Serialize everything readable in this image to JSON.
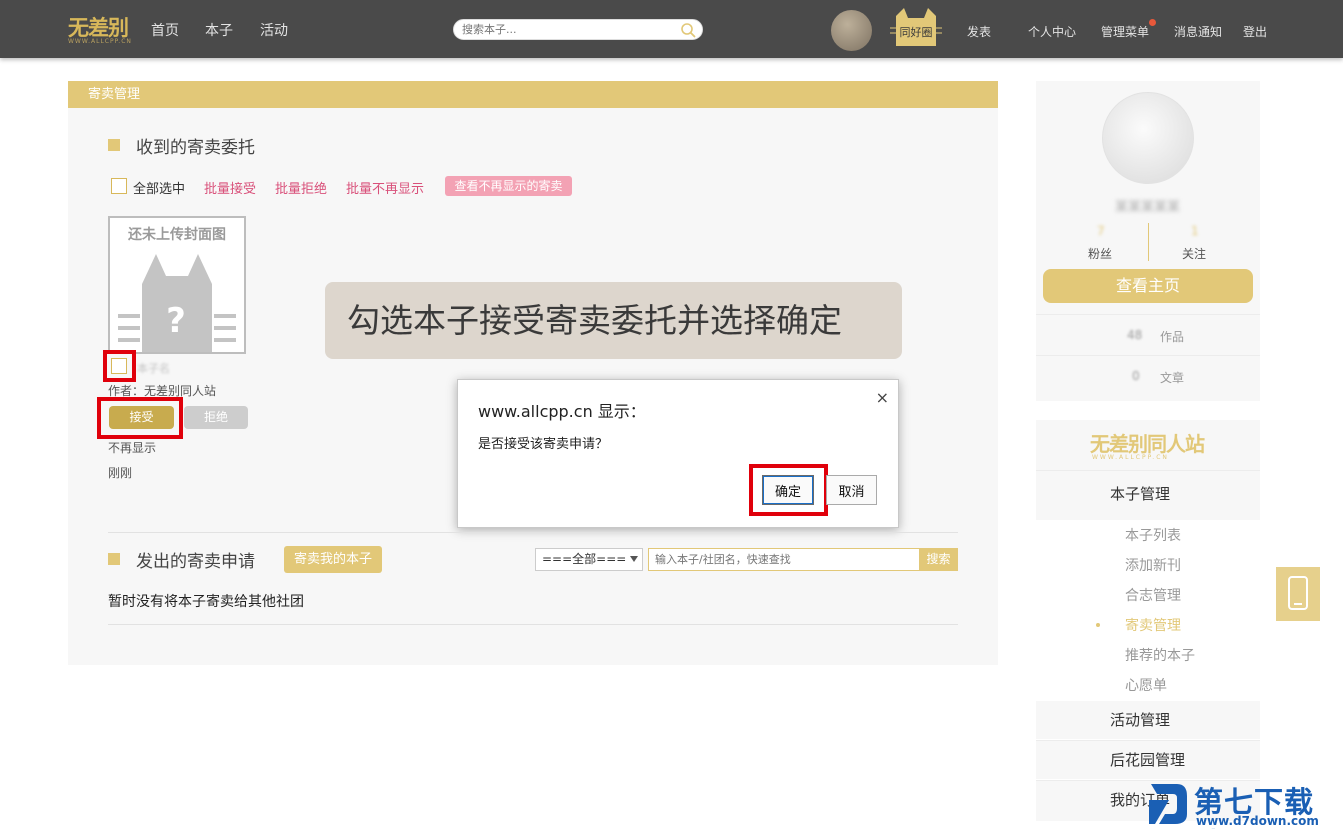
{
  "header": {
    "logo_text": "无差别",
    "logo_sub": "WWW.ALLCPP.CN",
    "nav": [
      "首页",
      "本子",
      "活动"
    ],
    "search_placeholder": "搜索本子...",
    "cat_badge_label": "同好圈",
    "links": [
      "发表",
      "个人中心",
      "管理菜单",
      "消息通知",
      "登出"
    ]
  },
  "panel": {
    "header_title": "寄卖管理",
    "received_title": "收到的寄卖委托",
    "select_all": "全部选中",
    "batch_accept": "批量接受",
    "batch_reject": "批量拒绝",
    "batch_hide": "批量不再显示",
    "view_hidden": "查看不再显示的寄卖",
    "cover_text": "还未上传封面图",
    "book_name": "本子名",
    "author": "作者：无差别同人站",
    "accept": "接受",
    "reject": "拒绝",
    "hide": "不再显示",
    "time": "刚刚",
    "sent_title": "发出的寄卖申请",
    "consign_my_book": "寄卖我的本子",
    "filter_selected": "===全部===",
    "query_placeholder": "输入本子/社团名，快速查找",
    "query_button": "搜索",
    "no_consign": "暂时没有将本子寄卖给其他社团"
  },
  "tooltip": {
    "text": "勾选本子接受寄卖委托并选择确定"
  },
  "dialog": {
    "title": "www.allcpp.cn 显示：",
    "close": "×",
    "message": "是否接受该寄卖申请？",
    "ok": "确定",
    "cancel": "取消"
  },
  "sidebar": {
    "username": "某某某某某",
    "followers_count": "7",
    "followers_label": "粉丝",
    "following_count": "1",
    "following_label": "关注",
    "view_home": "查看主页",
    "works_count": "48",
    "works_label": "作品",
    "articles_count": "0",
    "articles_label": "文章",
    "menu_logo": "无差别同人站",
    "menu_logo_sub": "WWW.ALLCPP.CN",
    "book_manage": "本子管理",
    "sub_items": [
      "本子列表",
      "添加新刊",
      "合志管理",
      "寄卖管理",
      "推荐的本子",
      "心愿单"
    ],
    "activity_manage": "活动管理",
    "garden_manage": "后花园管理",
    "my_orders": "我的订单"
  },
  "watermark": {
    "text": "第七下载站",
    "url": "www.d7down.com"
  },
  "colors": {
    "topbar": "#4a4a4a",
    "accent": "#e2c878",
    "pink": "#d9507a",
    "highlight_red": "#e0000b"
  }
}
